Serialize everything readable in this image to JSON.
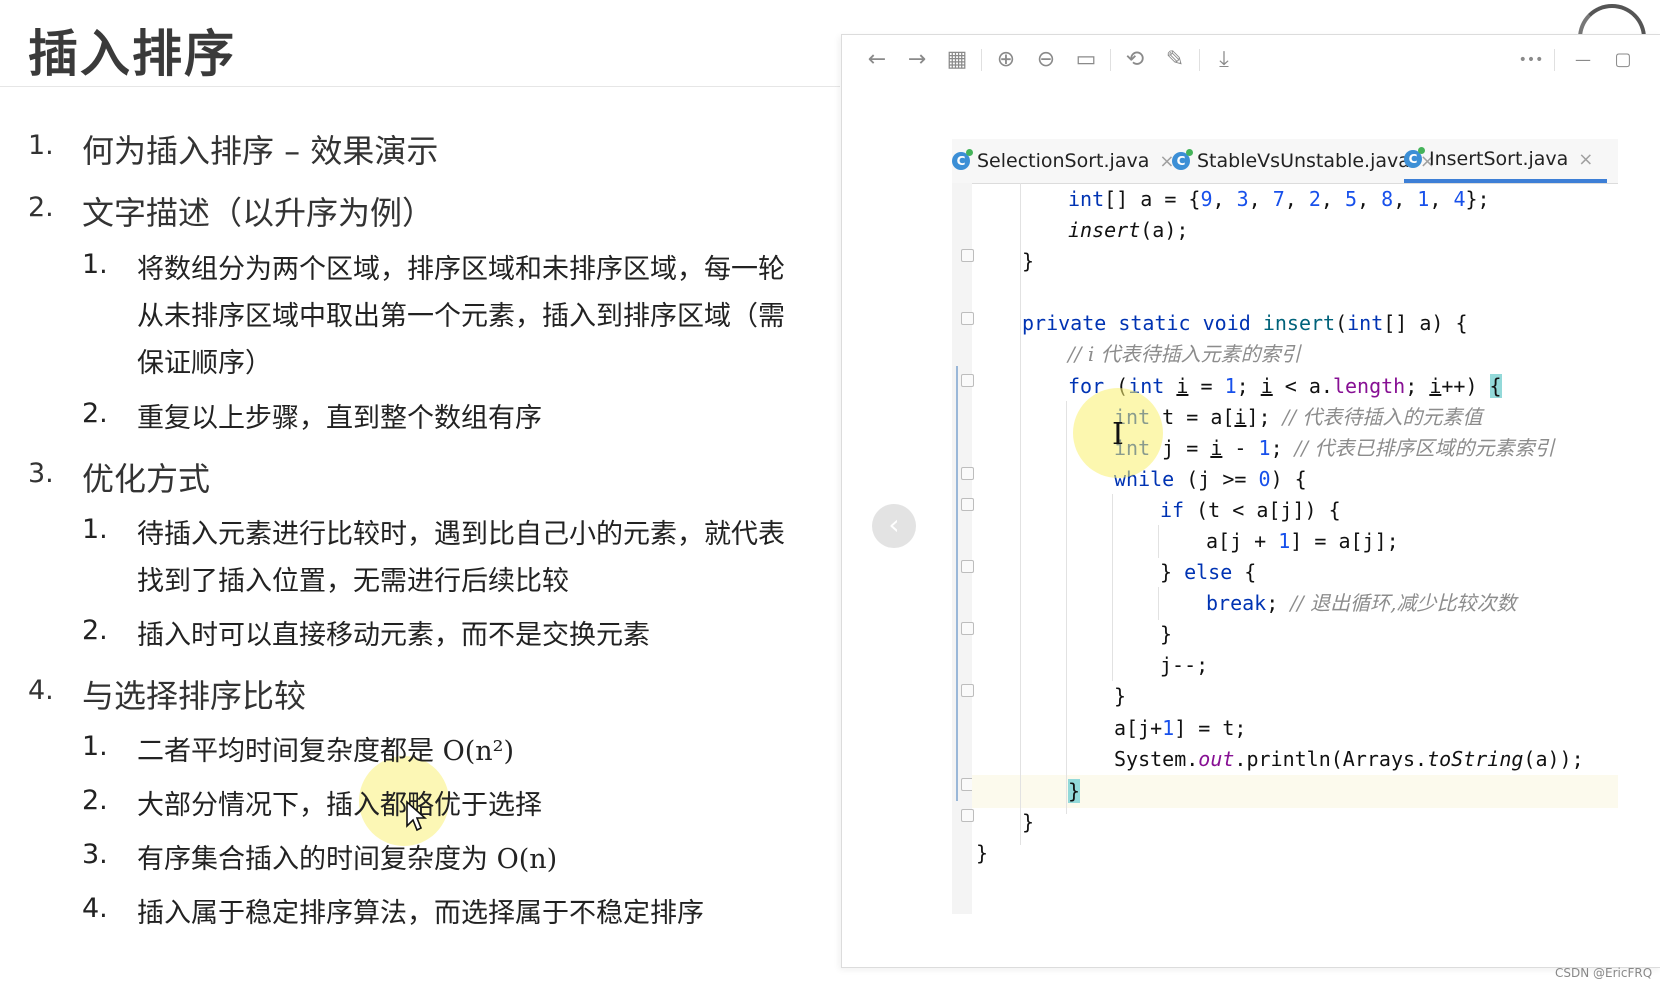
{
  "slide": {
    "title": "插入排序",
    "items": [
      {
        "num": "1.",
        "text": "何为插入排序 – 效果演示"
      },
      {
        "num": "2.",
        "text": "文字描述（以升序为例）",
        "sub": [
          {
            "num": "1.",
            "lines": [
              "将数组分为两个区域，排序区域和未排序区域，每一轮",
              "从未排序区域中取出第一个元素，插入到排序区域（需",
              "保证顺序）"
            ]
          },
          {
            "num": "2.",
            "lines": [
              "重复以上步骤，直到整个数组有序"
            ]
          }
        ]
      },
      {
        "num": "3.",
        "text": "优化方式",
        "sub": [
          {
            "num": "1.",
            "lines": [
              "待插入元素进行比较时，遇到比自己小的元素，就代表",
              "找到了插入位置，无需进行后续比较"
            ]
          },
          {
            "num": "2.",
            "lines": [
              "插入时可以直接移动元素，而不是交换元素"
            ]
          }
        ]
      },
      {
        "num": "4.",
        "text": "与选择排序比较",
        "sub": [
          {
            "num": "1.",
            "text": "二者平均时间复杂度都是",
            "math": "O(n²)"
          },
          {
            "num": "2.",
            "text": "大部分情况下，插入都略优于选择"
          },
          {
            "num": "3.",
            "text": "有序集合插入的时间复杂度为",
            "math": "O(n)"
          },
          {
            "num": "4.",
            "text": "插入属于稳定排序算法，而选择属于不稳定排序"
          }
        ]
      }
    ]
  },
  "viewer": {
    "toolbar": [
      "back-icon",
      "forward-icon",
      "grid-icon",
      "zoom-in-icon",
      "zoom-out-icon",
      "fit-page-icon",
      "rotate-icon",
      "edit-icon",
      "download-icon",
      "more-icon",
      "minimize-icon",
      "maximize-icon"
    ],
    "glyphs": {
      "back": "←",
      "forward": "→",
      "grid": "▦",
      "zoom_in": "⊕",
      "zoom_out": "⊖",
      "fit": "▭",
      "rotate": "⟲",
      "edit": "✎",
      "download": "⤓",
      "more": "•••",
      "minimize": "—",
      "maximize": "▢",
      "prev": "‹"
    }
  },
  "ide": {
    "tabs": [
      {
        "label": "SelectionSort.java",
        "active": false
      },
      {
        "label": "StableVsUnstable.java",
        "active": false
      },
      {
        "label": "InsertSort.java",
        "active": true
      }
    ],
    "tab_close": "×",
    "code": {
      "l1": {
        "pre": "int[] a = {",
        "nums": [
          "9",
          "3",
          "7",
          "2",
          "5",
          "8",
          "1",
          "4"
        ],
        "post": "};"
      },
      "l2": {
        "fn": "insert",
        "rest": "(a);"
      },
      "close": "}",
      "sig": {
        "kw": "private static void",
        "name": "insert",
        "params_kw": "int",
        "params_rest": "[] a) {"
      },
      "c1": "// i 代表待插入元素的索引",
      "for": {
        "kw": "for",
        "p1": " (",
        "int": "int",
        "p2": " ",
        "i1": "i",
        "eq": " = ",
        "one": "1",
        "semi": "; ",
        "i2": "i",
        "lt": " < a.",
        "length": "length",
        "semi2": "; ",
        "i3": "i",
        "inc": "++) ",
        "brace": "{"
      },
      "t": {
        "int": "int",
        "rest1": " t = a[",
        "i": "i",
        "rest2": "]; ",
        "cm": "// 代表待插入的元素值"
      },
      "j": {
        "int": "int",
        "rest1": " j = ",
        "i": "i",
        "rest2": " - ",
        "one": "1",
        "rest3": "; ",
        "cm": "// 代表已排序区域的元素索引"
      },
      "while": {
        "kw": "while",
        "rest1": " (j >= ",
        "zero": "0",
        "rest2": ") {"
      },
      "if": {
        "kw": "if",
        "rest": " (t < a[j]) {"
      },
      "assign": {
        "a": "a[j + ",
        "one": "1",
        "b": "] = a[j];"
      },
      "else": {
        "a": "} ",
        "kw": "else",
        "b": " {"
      },
      "break": {
        "kw": "break",
        "semi": "; ",
        "cm": "// 退出循环,减少比较次数"
      },
      "jdec": "j--;",
      "set": {
        "a": "a[j+",
        "one": "1",
        "b": "] = t;"
      },
      "println": {
        "a": "System.",
        "out": "out",
        "b": ".println(Arrays.",
        "fn": "toString",
        "c": "(a));"
      }
    }
  },
  "watermark": "CSDN @EricFRQ"
}
